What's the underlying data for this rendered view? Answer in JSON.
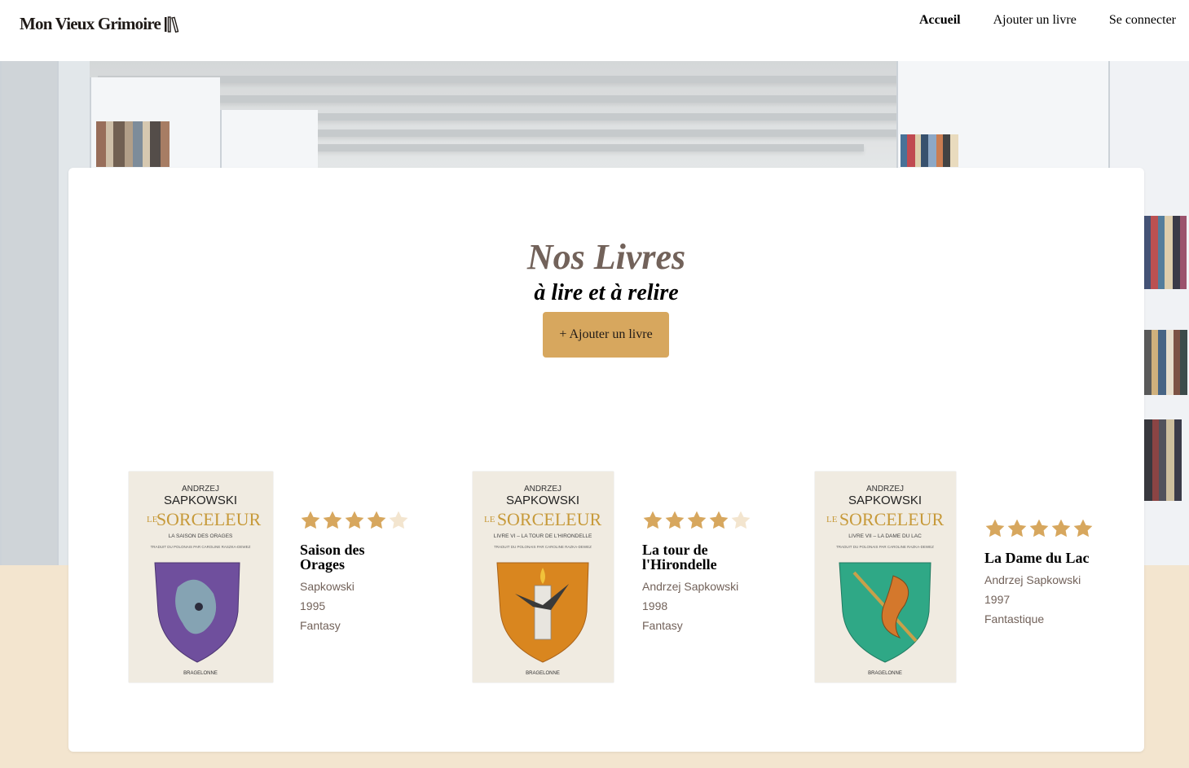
{
  "header": {
    "logo_text": "Mon Vieux Grimoire",
    "nav": [
      {
        "label": "Accueil",
        "active": true
      },
      {
        "label": "Ajouter un livre",
        "active": false
      },
      {
        "label": "Se connecter",
        "active": false
      }
    ]
  },
  "main": {
    "title": "Nos Livres",
    "subtitle": "à lire et à relire",
    "add_button_label": "+ Ajouter un livre"
  },
  "books": [
    {
      "title": "Saison des Orages",
      "author": "Sapkowski",
      "year": "1995",
      "genre": "Fantasy",
      "rating": 4,
      "rating_max": 5,
      "cover": {
        "author": "ANDRZEJ",
        "surname": "SAPKOWSKI",
        "series_le": "LE",
        "series": "SORCELEUR",
        "subtitle": "LA SAISON DES ORAGES",
        "translator": "TRADUIT DU POLONAIS PAR CAROLINE RASZKA-DEWEZ",
        "publisher": "BRAGELONNE",
        "shield_color": "#6f4f9d"
      }
    },
    {
      "title": "La tour de l'Hirondelle",
      "author": "Andrzej Sapkowski",
      "year": "1998",
      "genre": "Fantasy",
      "rating": 4,
      "rating_max": 5,
      "cover": {
        "author": "ANDRZEJ",
        "surname": "SAPKOWSKI",
        "series_le": "LE",
        "series": "SORCELEUR",
        "subtitle": "LIVRE VI – LA TOUR DE L'HIRONDELLE",
        "translator": "TRADUIT DU POLONAIS PAR CAROLINE RAZKA-DEWEZ",
        "publisher": "BRAGELONNE",
        "shield_color": "#d9861f"
      }
    },
    {
      "title": "La Dame du Lac",
      "author": "Andrzej Sapkowski",
      "year": "1997",
      "genre": "Fantastique",
      "rating": 5,
      "rating_max": 5,
      "cover": {
        "author": "ANDRZEJ",
        "surname": "SAPKOWSKI",
        "series_le": "LE",
        "series": "SORCELEUR",
        "subtitle": "LIVRE VII – LA DAME DU LAC",
        "translator": "TRADUIT DU POLONAIS PAR CAROLINE RAZKA-DEWEZ",
        "publisher": "BRAGELONNE",
        "shield_color": "#2fa886"
      }
    }
  ],
  "colors": {
    "accent": "#d7a75e",
    "star_filled": "#d7a75e",
    "star_empty": "#f3e5cf",
    "text_brown": "#72625a",
    "beige_band": "#f3e5cf"
  },
  "icons": {
    "logo": "books-icon",
    "rating": "star-icon",
    "hero": "library-photo"
  }
}
